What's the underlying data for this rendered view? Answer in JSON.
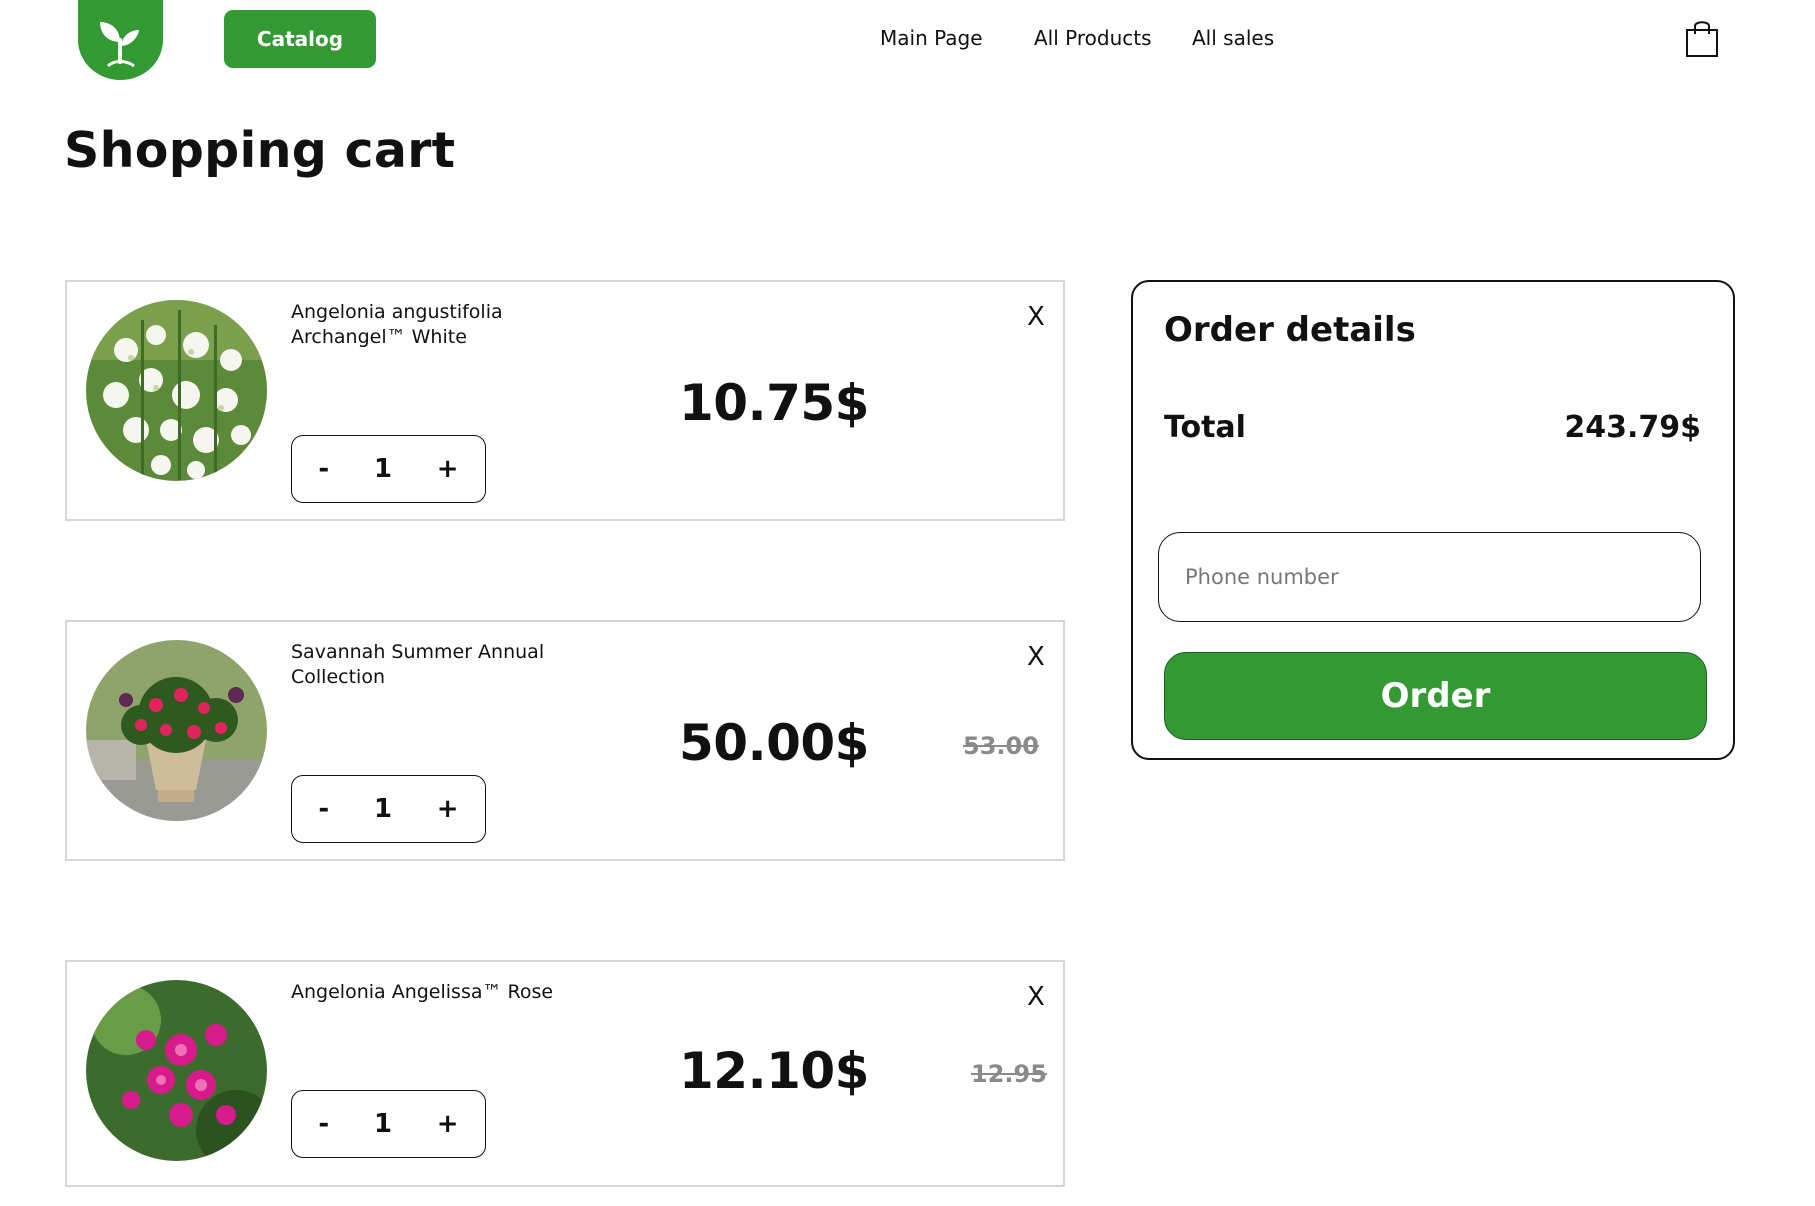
{
  "header": {
    "catalog_label": "Catalog",
    "nav": [
      "Main Page",
      "All Products",
      "All sales"
    ]
  },
  "page": {
    "title": "Shopping cart"
  },
  "cart": {
    "items": [
      {
        "name": "Angelonia angustifolia Archangel™ White",
        "price": "10.75$",
        "old_price": "",
        "quantity": "1"
      },
      {
        "name": "Savannah Summer Annual Collection",
        "price": "50.00$",
        "old_price": "53.00",
        "quantity": "1"
      },
      {
        "name": "Angelonia Angelissa™ Rose",
        "price": "12.10$",
        "old_price": "12.95",
        "quantity": "1"
      }
    ],
    "remove_label": "X",
    "minus_label": "-",
    "plus_label": "+"
  },
  "order": {
    "title": "Order details",
    "total_label": "Total",
    "total_value": "243.79$",
    "phone_placeholder": "Phone number",
    "order_label": "Order"
  },
  "colors": {
    "accent": "#339933"
  },
  "icons": {
    "logo": "sprout-icon",
    "cart": "shopping-bag-icon",
    "remove": "close-icon"
  }
}
